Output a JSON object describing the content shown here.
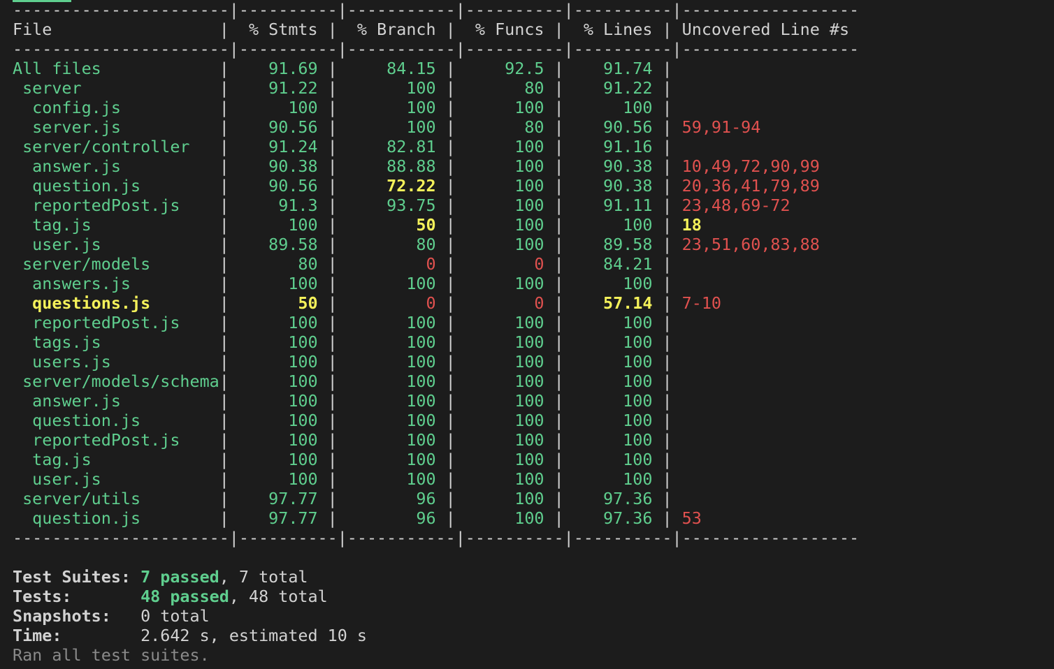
{
  "colors": {
    "background": "#1c1c1c",
    "text": "#d2d2d2",
    "green": "#5fce8e",
    "yellow": "#f4f15a",
    "red": "#e0514f",
    "dim": "#8a8a8a"
  },
  "table": {
    "headers": {
      "file": "File",
      "stmts": "% Stmts",
      "branch": "% Branch",
      "funcs": "% Funcs",
      "lines": "% Lines",
      "uncovered": "Uncovered Line #s"
    },
    "rows": [
      {
        "indent": 0,
        "file": "All files",
        "stmts": "91.69",
        "branch": "84.15",
        "funcs": "92.5",
        "lines": "91.74",
        "uncovered": "",
        "c": [
          "g",
          "g",
          "g",
          "g",
          "g",
          "r"
        ]
      },
      {
        "indent": 1,
        "file": "server",
        "stmts": "91.22",
        "branch": "100",
        "funcs": "80",
        "lines": "91.22",
        "uncovered": "",
        "c": [
          "g",
          "g",
          "g",
          "g",
          "g",
          "r"
        ]
      },
      {
        "indent": 2,
        "file": "config.js",
        "stmts": "100",
        "branch": "100",
        "funcs": "100",
        "lines": "100",
        "uncovered": "",
        "c": [
          "g",
          "g",
          "g",
          "g",
          "g",
          "r"
        ]
      },
      {
        "indent": 2,
        "file": "server.js",
        "stmts": "90.56",
        "branch": "100",
        "funcs": "80",
        "lines": "90.56",
        "uncovered": "59,91-94",
        "c": [
          "g",
          "g",
          "g",
          "g",
          "g",
          "r"
        ]
      },
      {
        "indent": 1,
        "file": "server/controller",
        "stmts": "91.24",
        "branch": "82.81",
        "funcs": "100",
        "lines": "91.16",
        "uncovered": "",
        "c": [
          "g",
          "g",
          "g",
          "g",
          "g",
          "r"
        ]
      },
      {
        "indent": 2,
        "file": "answer.js",
        "stmts": "90.38",
        "branch": "88.88",
        "funcs": "100",
        "lines": "90.38",
        "uncovered": "10,49,72,90,99",
        "c": [
          "g",
          "g",
          "g",
          "g",
          "g",
          "r"
        ]
      },
      {
        "indent": 2,
        "file": "question.js",
        "stmts": "90.56",
        "branch": "72.22",
        "funcs": "100",
        "lines": "90.38",
        "uncovered": "20,36,41,79,89",
        "c": [
          "g",
          "g",
          "y",
          "g",
          "g",
          "r"
        ]
      },
      {
        "indent": 2,
        "file": "reportedPost.js",
        "stmts": "91.3",
        "branch": "93.75",
        "funcs": "100",
        "lines": "91.11",
        "uncovered": "23,48,69-72",
        "c": [
          "g",
          "g",
          "g",
          "g",
          "g",
          "r"
        ]
      },
      {
        "indent": 2,
        "file": "tag.js",
        "stmts": "100",
        "branch": "50",
        "funcs": "100",
        "lines": "100",
        "uncovered": "18",
        "c": [
          "g",
          "g",
          "y",
          "g",
          "g",
          "y"
        ]
      },
      {
        "indent": 2,
        "file": "user.js",
        "stmts": "89.58",
        "branch": "80",
        "funcs": "100",
        "lines": "89.58",
        "uncovered": "23,51,60,83,88",
        "c": [
          "g",
          "g",
          "g",
          "g",
          "g",
          "r"
        ]
      },
      {
        "indent": 1,
        "file": "server/models",
        "stmts": "80",
        "branch": "0",
        "funcs": "0",
        "lines": "84.21",
        "uncovered": "",
        "c": [
          "g",
          "g",
          "r",
          "r",
          "g",
          "r"
        ]
      },
      {
        "indent": 2,
        "file": "answers.js",
        "stmts": "100",
        "branch": "100",
        "funcs": "100",
        "lines": "100",
        "uncovered": "",
        "c": [
          "g",
          "g",
          "g",
          "g",
          "g",
          "r"
        ]
      },
      {
        "indent": 2,
        "file": "questions.js",
        "stmts": "50",
        "branch": "0",
        "funcs": "0",
        "lines": "57.14",
        "uncovered": "7-10",
        "c": [
          "y",
          "y",
          "r",
          "r",
          "y",
          "r"
        ]
      },
      {
        "indent": 2,
        "file": "reportedPost.js",
        "stmts": "100",
        "branch": "100",
        "funcs": "100",
        "lines": "100",
        "uncovered": "",
        "c": [
          "g",
          "g",
          "g",
          "g",
          "g",
          "r"
        ]
      },
      {
        "indent": 2,
        "file": "tags.js",
        "stmts": "100",
        "branch": "100",
        "funcs": "100",
        "lines": "100",
        "uncovered": "",
        "c": [
          "g",
          "g",
          "g",
          "g",
          "g",
          "r"
        ]
      },
      {
        "indent": 2,
        "file": "users.js",
        "stmts": "100",
        "branch": "100",
        "funcs": "100",
        "lines": "100",
        "uncovered": "",
        "c": [
          "g",
          "g",
          "g",
          "g",
          "g",
          "r"
        ]
      },
      {
        "indent": 1,
        "file": "server/models/schema",
        "stmts": "100",
        "branch": "100",
        "funcs": "100",
        "lines": "100",
        "uncovered": "",
        "c": [
          "g",
          "g",
          "g",
          "g",
          "g",
          "r"
        ]
      },
      {
        "indent": 2,
        "file": "answer.js",
        "stmts": "100",
        "branch": "100",
        "funcs": "100",
        "lines": "100",
        "uncovered": "",
        "c": [
          "g",
          "g",
          "g",
          "g",
          "g",
          "r"
        ]
      },
      {
        "indent": 2,
        "file": "question.js",
        "stmts": "100",
        "branch": "100",
        "funcs": "100",
        "lines": "100",
        "uncovered": "",
        "c": [
          "g",
          "g",
          "g",
          "g",
          "g",
          "r"
        ]
      },
      {
        "indent": 2,
        "file": "reportedPost.js",
        "stmts": "100",
        "branch": "100",
        "funcs": "100",
        "lines": "100",
        "uncovered": "",
        "c": [
          "g",
          "g",
          "g",
          "g",
          "g",
          "r"
        ]
      },
      {
        "indent": 2,
        "file": "tag.js",
        "stmts": "100",
        "branch": "100",
        "funcs": "100",
        "lines": "100",
        "uncovered": "",
        "c": [
          "g",
          "g",
          "g",
          "g",
          "g",
          "r"
        ]
      },
      {
        "indent": 2,
        "file": "user.js",
        "stmts": "100",
        "branch": "100",
        "funcs": "100",
        "lines": "100",
        "uncovered": "",
        "c": [
          "g",
          "g",
          "g",
          "g",
          "g",
          "r"
        ]
      },
      {
        "indent": 1,
        "file": "server/utils",
        "stmts": "97.77",
        "branch": "96",
        "funcs": "100",
        "lines": "97.36",
        "uncovered": "",
        "c": [
          "g",
          "g",
          "g",
          "g",
          "g",
          "r"
        ]
      },
      {
        "indent": 2,
        "file": "question.js",
        "stmts": "97.77",
        "branch": "96",
        "funcs": "100",
        "lines": "97.36",
        "uncovered": "53",
        "c": [
          "g",
          "g",
          "g",
          "g",
          "g",
          "r"
        ]
      }
    ]
  },
  "summary": {
    "suites": {
      "label": "Test Suites:",
      "passed": "7 passed",
      "rest": ", 7 total"
    },
    "tests": {
      "label": "Tests:",
      "passed": "48 passed",
      "rest": ", 48 total"
    },
    "snapshots": {
      "label": "Snapshots:",
      "value": "0 total"
    },
    "time": {
      "label": "Time:",
      "value": "2.642 s, estimated 10 s"
    },
    "footer": "Ran all test suites."
  }
}
